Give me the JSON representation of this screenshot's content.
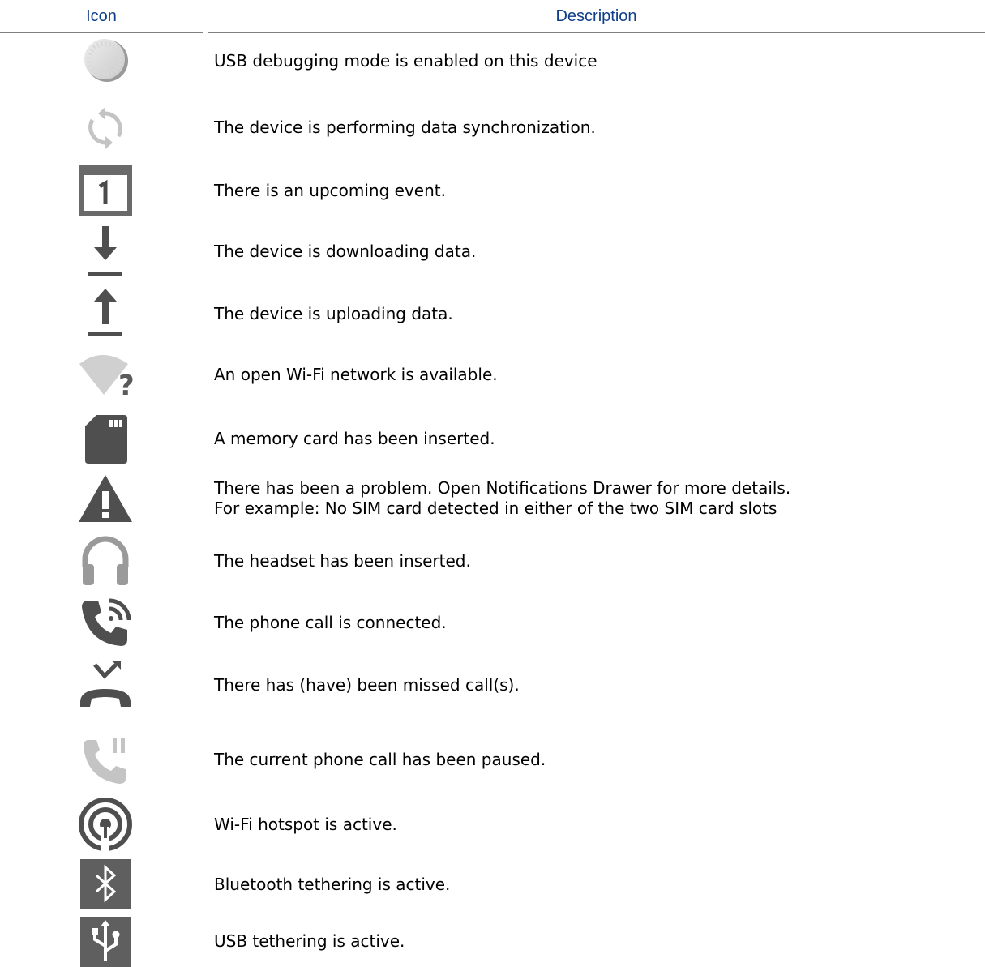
{
  "table": {
    "header": {
      "icon": "Icon",
      "description": "Description"
    },
    "rows": [
      {
        "icon": "usb-debugging-icon",
        "lines": [
          "USB debugging mode is enabled on this device"
        ]
      },
      {
        "icon": "sync-icon",
        "lines": [
          "The device is performing data synchronization."
        ]
      },
      {
        "icon": "calendar-event-icon",
        "lines": [
          "There is an upcoming event."
        ]
      },
      {
        "icon": "download-icon",
        "lines": [
          "The device is downloading data."
        ]
      },
      {
        "icon": "upload-icon",
        "lines": [
          "The device is uploading data."
        ]
      },
      {
        "icon": "open-wifi-icon",
        "lines": [
          "An open Wi-Fi network is available."
        ]
      },
      {
        "icon": "memory-card-icon",
        "lines": [
          "A memory card has been inserted."
        ]
      },
      {
        "icon": "warning-icon",
        "lines": [
          "There has been a problem. Open Notifications Drawer for more details.",
          "For example: No SIM card detected in either of the two SIM card slots"
        ]
      },
      {
        "icon": "headset-icon",
        "lines": [
          "The headset has been inserted."
        ]
      },
      {
        "icon": "call-connected-icon",
        "lines": [
          "The phone call is connected."
        ]
      },
      {
        "icon": "missed-call-icon",
        "lines": [
          "There has (have) been missed call(s)."
        ]
      },
      {
        "icon": "call-paused-icon",
        "lines": [
          "The current phone call has been paused."
        ]
      },
      {
        "icon": "wifi-hotspot-icon",
        "lines": [
          "Wi-Fi hotspot is active."
        ]
      },
      {
        "icon": "bluetooth-tethering-icon",
        "lines": [
          "Bluetooth tethering is active."
        ]
      },
      {
        "icon": "usb-tethering-icon",
        "lines": [
          "USB tethering is active."
        ]
      }
    ]
  },
  "colors": {
    "header_text": "#0f3e8a",
    "icon_dark": "#555555",
    "icon_mid": "#888888",
    "icon_light": "#b5b5b5"
  }
}
